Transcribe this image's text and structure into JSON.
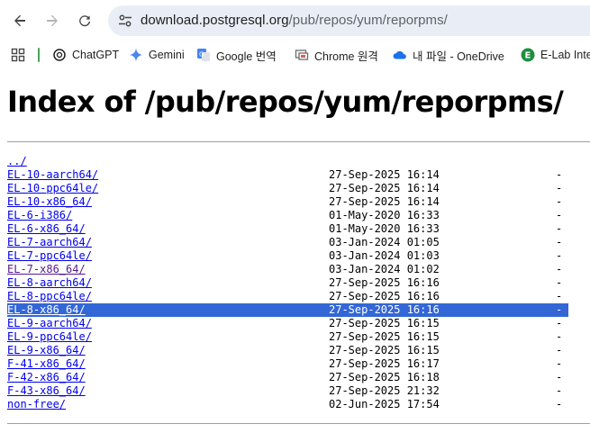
{
  "browser": {
    "url_host": "download.postgresql.org",
    "url_path": "/pub/repos/yum/reporpms/"
  },
  "bookmarks": [
    {
      "label": "ChatGPT",
      "icon": "chatgpt-icon"
    },
    {
      "label": "Gemini",
      "icon": "gemini-icon"
    },
    {
      "label": "Google 번역",
      "icon": "google-translate-icon"
    },
    {
      "label": "Chrome 원격",
      "icon": "chrome-remote-icon"
    },
    {
      "label": "내 파일 - OneDrive",
      "icon": "onedrive-icon"
    },
    {
      "label": "E-Lab Inte",
      "icon": "elab-icon"
    }
  ],
  "page": {
    "title": "Index of /pub/repos/yum/reporpms/",
    "parent_link": "../",
    "entries": [
      {
        "name": "EL-10-aarch64/",
        "date": "27-Sep-2025 16:14",
        "size": "-"
      },
      {
        "name": "EL-10-ppc64le/",
        "date": "27-Sep-2025 16:14",
        "size": "-"
      },
      {
        "name": "EL-10-x86_64/",
        "date": "27-Sep-2025 16:14",
        "size": "-"
      },
      {
        "name": "EL-6-i386/",
        "date": "01-May-2020 16:33",
        "size": "-"
      },
      {
        "name": "EL-6-x86_64/",
        "date": "01-May-2020 16:33",
        "size": "-"
      },
      {
        "name": "EL-7-aarch64/",
        "date": "03-Jan-2024 01:05",
        "size": "-"
      },
      {
        "name": "EL-7-ppc64le/",
        "date": "03-Jan-2024 01:03",
        "size": "-"
      },
      {
        "name": "EL-7-x86_64/",
        "date": "03-Jan-2024 01:02",
        "size": "-"
      },
      {
        "name": "EL-8-aarch64/",
        "date": "27-Sep-2025 16:16",
        "size": "-"
      },
      {
        "name": "EL-8-ppc64le/",
        "date": "27-Sep-2025 16:16",
        "size": "-"
      },
      {
        "name": "EL-8-x86_64/",
        "date": "27-Sep-2025 16:16",
        "size": "-"
      },
      {
        "name": "EL-9-aarch64/",
        "date": "27-Sep-2025 16:15",
        "size": "-"
      },
      {
        "name": "EL-9-ppc64le/",
        "date": "27-Sep-2025 16:15",
        "size": "-"
      },
      {
        "name": "EL-9-x86_64/",
        "date": "27-Sep-2025 16:15",
        "size": "-"
      },
      {
        "name": "F-41-x86_64/",
        "date": "27-Sep-2025 16:17",
        "size": "-"
      },
      {
        "name": "F-42-x86_64/",
        "date": "27-Sep-2025 16:18",
        "size": "-"
      },
      {
        "name": "F-43-x86_64/",
        "date": "27-Sep-2025 21:32",
        "size": "-"
      },
      {
        "name": "non-free/",
        "date": "02-Jun-2025 17:54",
        "size": "-"
      }
    ]
  },
  "colors": {
    "link": "#0000ee",
    "visited_link": "#551a8b",
    "selection": "#3367d6",
    "omnibox": "#e9eef6"
  }
}
